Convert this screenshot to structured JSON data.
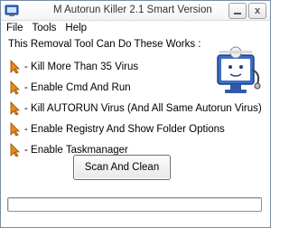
{
  "window": {
    "title": "M Autorun Killer 2.1 Smart Version",
    "minimize_label": "_",
    "close_label": "x"
  },
  "menu": {
    "items": [
      {
        "label": "File"
      },
      {
        "label": "Tools"
      },
      {
        "label": "Help"
      }
    ]
  },
  "main": {
    "heading": "This Removal Tool Can Do These Works :",
    "features": [
      {
        "label": "- Kill More Than 35 Virus"
      },
      {
        "label": "- Enable Cmd And Run"
      },
      {
        "label": "- Kill AUTORUN Virus (And All Same Autorun Virus)"
      },
      {
        "label": "- Enable Registry And Show Folder Options"
      },
      {
        "label": "- Enable Taskmanager"
      }
    ],
    "scan_button_label": "Scan And Clean",
    "progress_fraction": 0
  },
  "icons": {
    "title": "app-icon",
    "bullet": "arrow-cursor-icon",
    "logo": "doctor-computer-icon"
  },
  "colors": {
    "bullet_orange": "#e98a17",
    "logo_blue": "#3a6fc4",
    "progress_green": "#3fb54a"
  }
}
